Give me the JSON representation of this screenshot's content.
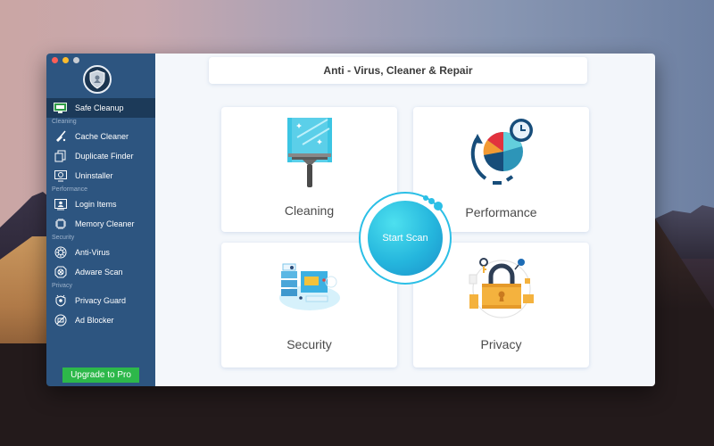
{
  "window": {
    "title": "Anti - Virus, Cleaner & Repair"
  },
  "sidebar": {
    "logo_icon": "shield-icon",
    "active_item": "Safe Cleanup",
    "top_item": {
      "label": "Safe Cleanup",
      "icon": "monitor-icon"
    },
    "sections": [
      {
        "label": "Cleaning",
        "items": [
          {
            "label": "Cache Cleaner",
            "icon": "broom-icon"
          },
          {
            "label": "Duplicate Finder",
            "icon": "duplicate-files-icon"
          },
          {
            "label": "Uninstaller",
            "icon": "uninstall-monitor-icon"
          }
        ]
      },
      {
        "label": "Performance",
        "items": [
          {
            "label": "Login Items",
            "icon": "login-user-icon"
          },
          {
            "label": "Memory Cleaner",
            "icon": "chip-icon"
          }
        ]
      },
      {
        "label": "Security",
        "items": [
          {
            "label": "Anti-Virus",
            "icon": "virus-icon"
          },
          {
            "label": "Adware Scan",
            "icon": "adware-scan-icon"
          }
        ]
      },
      {
        "label": "Privacy",
        "items": [
          {
            "label": "Privacy Guard",
            "icon": "privacy-guard-icon"
          },
          {
            "label": "Ad Blocker",
            "icon": "ad-blocker-icon"
          }
        ]
      }
    ],
    "upgrade_label": "Upgrade to Pro",
    "upgrade_color": "#2db84a"
  },
  "main": {
    "cards": [
      {
        "label": "Cleaning",
        "icon": "squeegee-icon"
      },
      {
        "label": "Performance",
        "icon": "performance-pie-clock-icon"
      },
      {
        "label": "Security",
        "icon": "security-server-icon"
      },
      {
        "label": "Privacy",
        "icon": "padlock-icon"
      }
    ],
    "scan_button_label": "Start Scan"
  },
  "colors": {
    "sidebar": "#2d5580",
    "sidebar_active": "#1c3a59",
    "accent": "#2bbfe6"
  }
}
